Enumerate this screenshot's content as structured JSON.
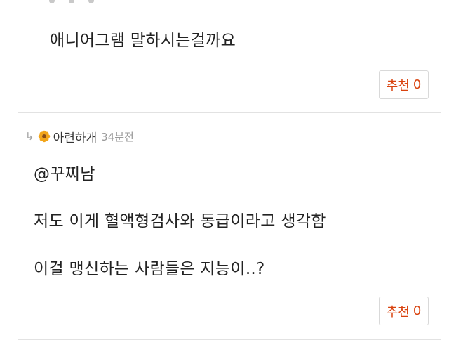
{
  "previous_reply": {
    "text": "애니어그램 말하시는걸까요",
    "recommend_label": "추천",
    "recommend_count": "0"
  },
  "comment": {
    "reply_arrow": "↳",
    "author_icon": "flower-icon",
    "author": "아련하개",
    "time": "34분전",
    "lines": [
      "@꾸찌남",
      "저도 이게 혈액형검사와 동급이라고 생각함",
      "이걸 맹신하는 사람들은 지능이..?"
    ],
    "recommend_label": "추천",
    "recommend_count": "0"
  },
  "colors": {
    "accent": "#d9430f",
    "text": "#222222",
    "muted": "#9a9a9a",
    "divider": "#e2e2e2",
    "flower": "#f2a51a"
  }
}
